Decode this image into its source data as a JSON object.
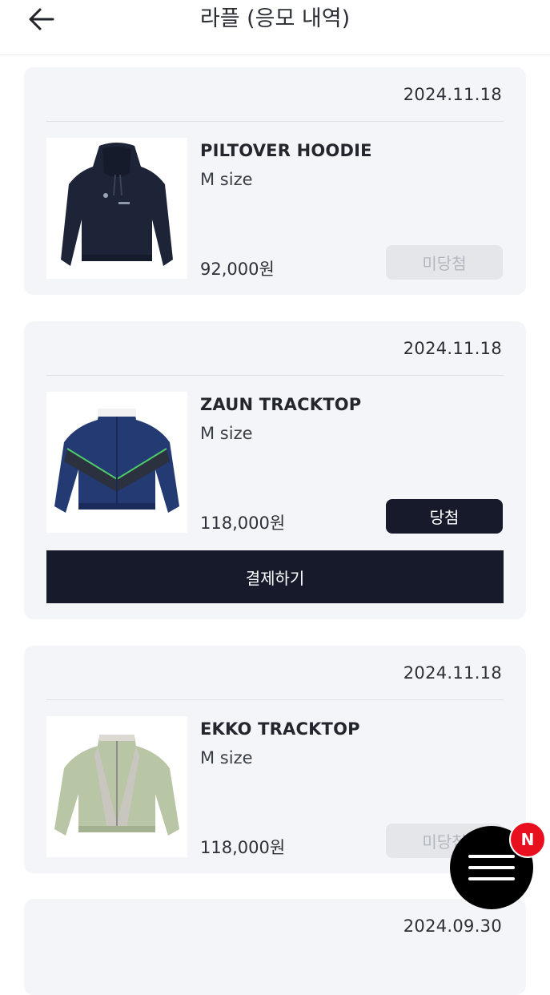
{
  "header": {
    "title": "라플 (응모 내역)",
    "back_icon": "arrow-left-icon"
  },
  "entries": [
    {
      "date": "2024.11.18",
      "name": "PILTOVER HOODIE",
      "size": "M size",
      "price": "92,000원",
      "status": "미당첨",
      "image": "navy-hoodie"
    },
    {
      "date": "2024.11.18",
      "name": "ZAUN TRACKTOP",
      "size": "M size",
      "price": "118,000원",
      "status": "당첨",
      "pay_label": "결제하기",
      "image": "navy-tracktop"
    },
    {
      "date": "2024.11.18",
      "name": "EKKO TRACKTOP",
      "size": "M size",
      "price": "118,000원",
      "status": "미당첨",
      "image": "sage-tracktop"
    },
    {
      "date": "2024.09.30"
    }
  ],
  "fab": {
    "icon": "menu-icon",
    "badge": "N",
    "badge_color": "#e8101f"
  },
  "colors": {
    "card_bg": "#f3f5f8",
    "dark_button": "#171a2b",
    "disabled_button": "#e4e6ea"
  }
}
